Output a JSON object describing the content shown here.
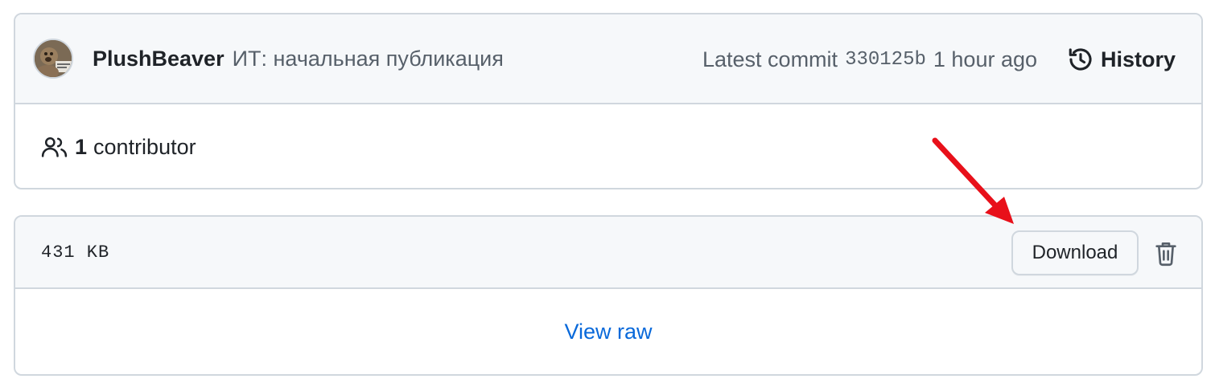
{
  "commit": {
    "author": "PlushBeaver",
    "message": "ИТ: начальная публикация",
    "latest_label": "Latest commit",
    "sha": "330125b",
    "time": "1 hour ago",
    "history_label": "History"
  },
  "contributors": {
    "count": "1",
    "label": "contributor"
  },
  "file": {
    "size": "431 KB",
    "download_label": "Download",
    "view_raw_label": "View raw"
  },
  "colors": {
    "link": "#0969da",
    "annotation_arrow": "#e8101a",
    "header_bg": "#f6f8fa",
    "border": "#d0d7de"
  },
  "icons": {
    "history": "history-icon",
    "people": "people-icon",
    "trash": "trash-icon",
    "avatar": "avatar-image"
  }
}
